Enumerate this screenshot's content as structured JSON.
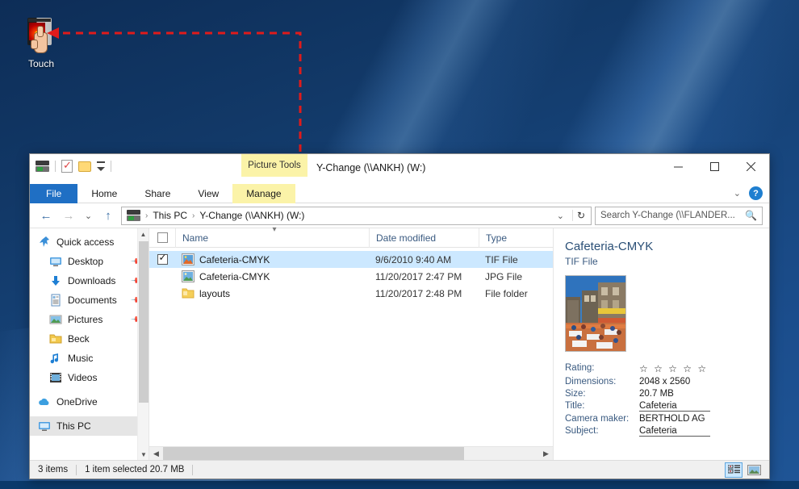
{
  "desktop": {
    "icon": {
      "label": "Touch",
      "name": "touch-icon"
    }
  },
  "annotation": {
    "color": "#e01b1b",
    "style": "dashed-arrow",
    "from_label": "file-row-cafeteria-tif",
    "to_label": "touch-desktop-icon"
  },
  "window": {
    "title": "Y-Change (\\\\ANKH) (W:)",
    "contextual_tab": "Picture Tools",
    "quick_access": {
      "drive_icon": "network-drive-icon",
      "properties_icon": "properties-icon",
      "new_folder_icon": "new-folder-icon",
      "customize_icon": "customize-quick-access-icon"
    },
    "controls": {
      "minimize": "—",
      "maximize": "☐",
      "close": "✕",
      "ribbon_collapse": "⌄",
      "help": "?"
    },
    "ribbon_tabs": [
      {
        "label": "File",
        "kind": "file"
      },
      {
        "label": "Home",
        "kind": "normal"
      },
      {
        "label": "Share",
        "kind": "normal"
      },
      {
        "label": "View",
        "kind": "normal"
      },
      {
        "label": "Manage",
        "kind": "contextual"
      }
    ],
    "address": {
      "back": "←",
      "forward": "→",
      "recent": "⌄",
      "up": "↑",
      "crumbs": [
        "This PC",
        "Y-Change (\\\\ANKH) (W:)"
      ],
      "separator": "›",
      "dropdown": "⌄",
      "refresh": "↻"
    },
    "search": {
      "placeholder": "Search Y-Change (\\\\FLANDER...",
      "icon": "search-icon"
    }
  },
  "sidebar": {
    "items": [
      {
        "label": "Quick access",
        "icon": "quick-access-icon",
        "indent": false,
        "pinned": false,
        "selected": false
      },
      {
        "label": "Desktop",
        "icon": "desktop-icon",
        "indent": true,
        "pinned": true,
        "selected": false
      },
      {
        "label": "Downloads",
        "icon": "downloads-icon",
        "indent": true,
        "pinned": true,
        "selected": false
      },
      {
        "label": "Documents",
        "icon": "documents-icon",
        "indent": true,
        "pinned": true,
        "selected": false
      },
      {
        "label": "Pictures",
        "icon": "pictures-icon",
        "indent": true,
        "pinned": true,
        "selected": false
      },
      {
        "label": "Beck",
        "icon": "folder-icon",
        "indent": true,
        "pinned": false,
        "selected": false
      },
      {
        "label": "Music",
        "icon": "music-icon",
        "indent": true,
        "pinned": false,
        "selected": false
      },
      {
        "label": "Videos",
        "icon": "videos-icon",
        "indent": true,
        "pinned": false,
        "selected": false
      },
      {
        "label": "OneDrive",
        "icon": "onedrive-icon",
        "indent": false,
        "pinned": false,
        "selected": false
      },
      {
        "label": "This PC",
        "icon": "this-pc-icon",
        "indent": false,
        "pinned": false,
        "selected": true
      }
    ]
  },
  "filelist": {
    "columns": [
      "Name",
      "Date modified",
      "Type"
    ],
    "rows": [
      {
        "name": "Cafeteria-CMYK",
        "date": "9/6/2010 9:40 AM",
        "type": "TIF File",
        "icon": "tif-image-icon",
        "checked": true,
        "selected": true
      },
      {
        "name": "Cafeteria-CMYK",
        "date": "11/20/2017 2:47 PM",
        "type": "JPG File",
        "icon": "jpg-image-icon",
        "checked": false,
        "selected": false
      },
      {
        "name": "layouts",
        "date": "11/20/2017 2:48 PM",
        "type": "File folder",
        "icon": "folder-icon",
        "checked": false,
        "selected": false
      }
    ]
  },
  "details": {
    "title": "Cafeteria-CMYK",
    "subtitle": "TIF File",
    "thumbnail": "cafeteria-street-photo",
    "properties": [
      {
        "key": "Rating:",
        "value": "☆ ☆ ☆ ☆ ☆",
        "kind": "stars"
      },
      {
        "key": "Dimensions:",
        "value": "2048 x 2560",
        "kind": "text"
      },
      {
        "key": "Size:",
        "value": "20.7 MB",
        "kind": "text"
      },
      {
        "key": "Title:",
        "value": "Cafeteria",
        "kind": "editable"
      },
      {
        "key": "Camera maker:",
        "value": "BERTHOLD AG",
        "kind": "text"
      },
      {
        "key": "Subject:",
        "value": "Cafeteria",
        "kind": "editable"
      }
    ]
  },
  "statusbar": {
    "item_count": "3 items",
    "selection": "1 item selected  20.7 MB",
    "view_details": "details-view-button",
    "view_large": "large-icons-view-button"
  }
}
